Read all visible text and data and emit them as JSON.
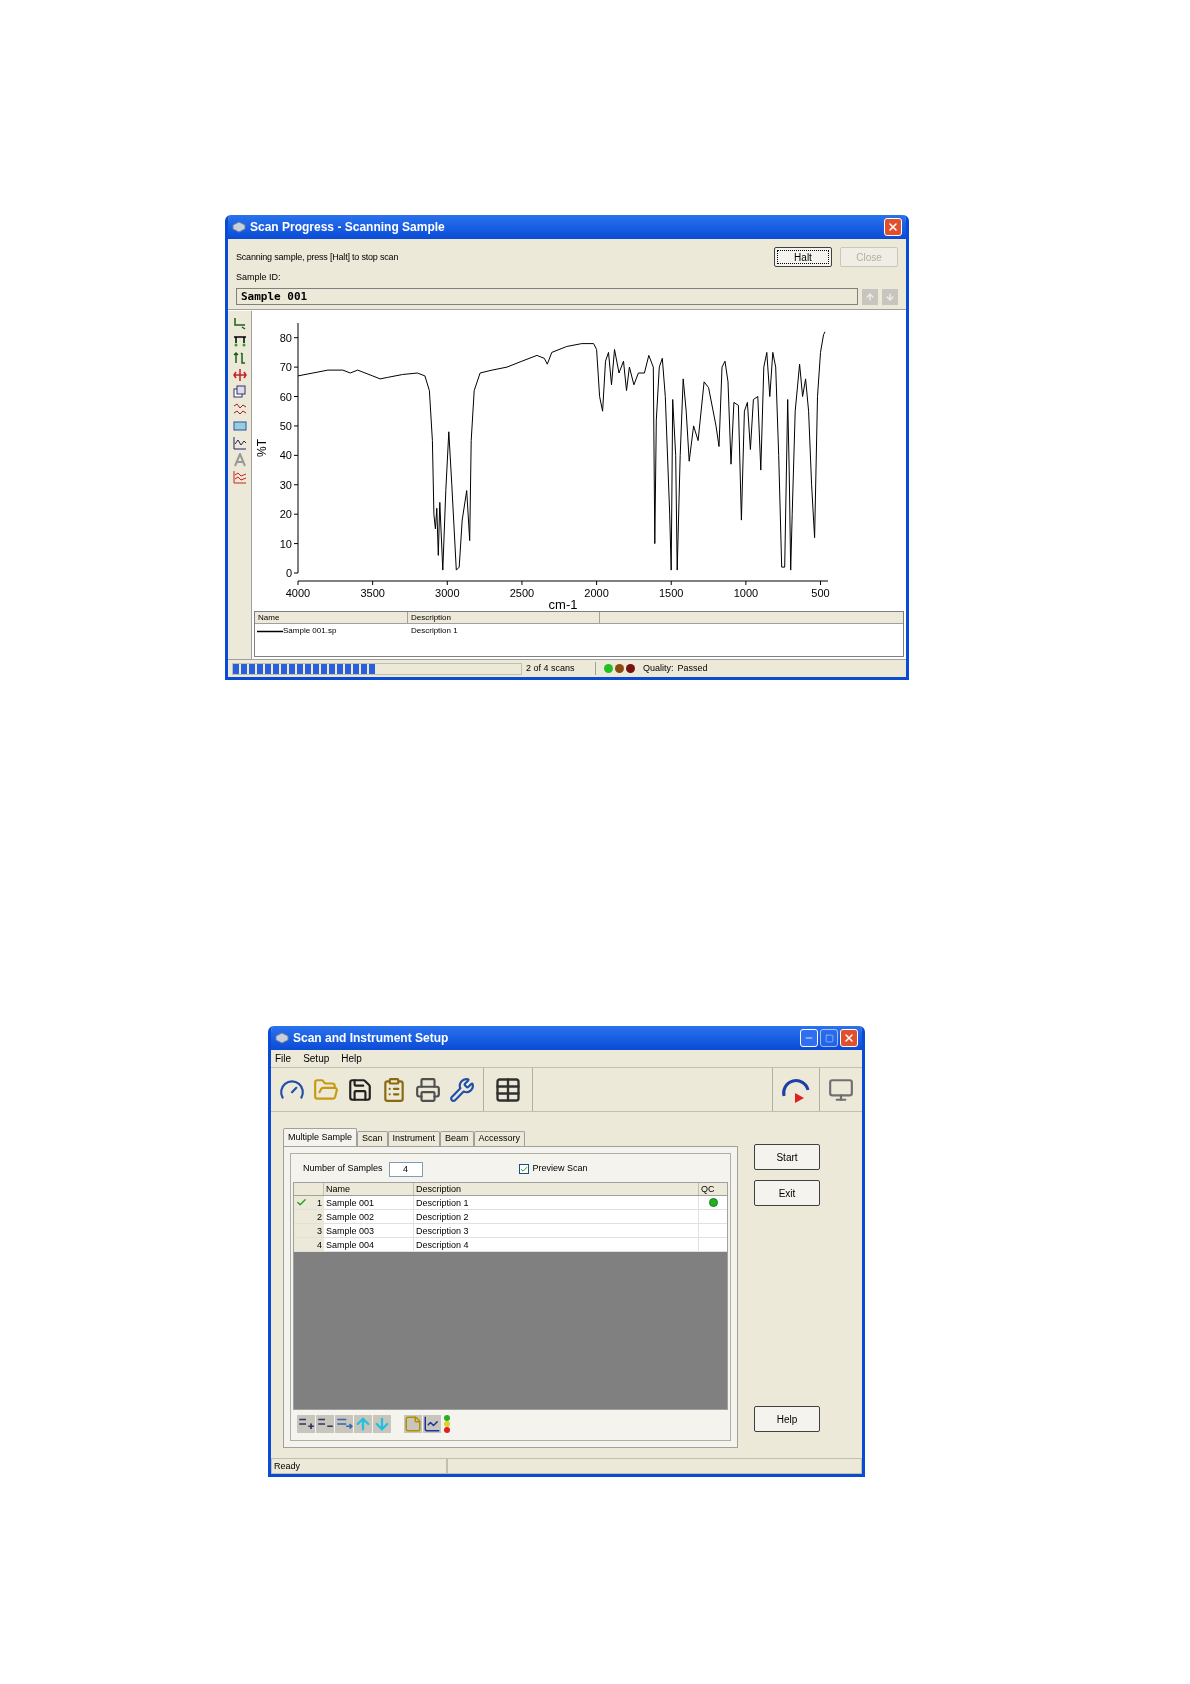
{
  "scan_progress_window": {
    "title": "Scan Progress - Scanning Sample",
    "message": "Scanning sample, press [Halt] to stop scan",
    "buttons": [
      {
        "label": "Halt",
        "disabled": false
      },
      {
        "label": "Close",
        "disabled": true
      }
    ],
    "sample_id_label": "Sample ID:",
    "sample_id_value": "Sample 001",
    "chart_data": {
      "type": "line",
      "xlabel": "cm-1",
      "ylabel": "%T",
      "xlim": [
        4000,
        450
      ],
      "ylim": [
        0,
        85
      ],
      "xticks": [
        4000,
        3500,
        3000,
        2500,
        2000,
        1500,
        1000,
        500
      ],
      "yticks": [
        0,
        10,
        20,
        30,
        40,
        50,
        60,
        70,
        80
      ],
      "x": [
        4000,
        3900,
        3800,
        3700,
        3650,
        3600,
        3500,
        3450,
        3400,
        3300,
        3200,
        3150,
        3120,
        3100,
        3090,
        3080,
        3070,
        3060,
        3050,
        3030,
        3010,
        2990,
        2970,
        2940,
        2920,
        2900,
        2870,
        2850,
        2840,
        2820,
        2780,
        2700,
        2600,
        2500,
        2400,
        2350,
        2330,
        2300,
        2200,
        2100,
        2020,
        2000,
        1980,
        1960,
        1940,
        1920,
        1900,
        1880,
        1850,
        1820,
        1800,
        1780,
        1750,
        1720,
        1680,
        1650,
        1620,
        1610,
        1600,
        1580,
        1560,
        1540,
        1510,
        1500,
        1490,
        1470,
        1460,
        1440,
        1420,
        1400,
        1380,
        1350,
        1320,
        1280,
        1250,
        1200,
        1180,
        1160,
        1140,
        1120,
        1100,
        1080,
        1050,
        1030,
        1010,
        990,
        970,
        950,
        920,
        900,
        880,
        860,
        840,
        820,
        800,
        780,
        760,
        740,
        720,
        710,
        700,
        690,
        670,
        640,
        620,
        600,
        580,
        560,
        540,
        520,
        500,
        480,
        470
      ],
      "series": [
        {
          "name": "Sample 001.sp",
          "color": "#000000",
          "values": [
            67,
            68,
            69,
            69,
            68,
            69,
            67,
            66,
            66.5,
            67.5,
            68,
            67,
            62,
            45,
            20,
            15,
            22,
            6,
            24,
            1,
            28,
            48,
            30,
            1,
            2,
            18,
            28,
            11,
            45,
            62,
            68,
            69,
            70,
            72,
            74,
            73,
            71,
            75,
            77,
            78,
            78,
            76,
            60,
            55,
            72,
            75,
            64,
            76,
            68,
            72,
            62,
            70,
            64,
            68,
            68,
            74,
            70,
            10,
            52,
            70,
            73,
            60,
            20,
            1,
            59,
            40,
            1,
            40,
            66,
            55,
            38,
            50,
            45,
            65,
            63,
            50,
            43,
            70,
            72,
            65,
            37,
            58,
            57,
            18,
            55,
            58,
            42,
            59,
            60,
            35,
            70,
            75,
            60,
            75,
            70,
            40,
            2,
            2,
            59,
            35,
            1,
            20,
            55,
            71,
            60,
            66,
            55,
            30,
            12,
            60,
            75,
            81,
            82
          ]
        }
      ]
    },
    "legend": {
      "columns": [
        "Name",
        "Description"
      ],
      "rows": [
        {
          "description": "Description 1"
        }
      ]
    },
    "status_bar": {
      "progress": {
        "level": 0.5
      },
      "scans": "2 of 4 scans",
      "quality_lights": [
        {
          "color": "#22c022"
        },
        {
          "color": "#8b4a12"
        },
        {
          "color": "#7a1010"
        }
      ],
      "quality_label": "Quality:",
      "quality_value": "Passed"
    }
  },
  "setup_window": {
    "title": "Scan and Instrument Setup",
    "menu": [
      "File",
      "Setup",
      "Help"
    ],
    "tabs": [
      {
        "label": "Multiple Sample",
        "selected": true
      },
      {
        "label": "Scan",
        "selected": false
      },
      {
        "label": "Instrument",
        "selected": false
      },
      {
        "label": "Beam",
        "selected": false
      },
      {
        "label": "Accessory",
        "selected": false
      }
    ],
    "number_of_samples_label": "Number of Samples",
    "number_of_samples": "4",
    "preview_scan": {
      "label": "Preview Scan",
      "checked": true
    },
    "table": {
      "columns": [
        "Name",
        "Description",
        "QC"
      ],
      "rows": [
        {
          "index": "1",
          "name": "Sample 001",
          "description": "Description 1",
          "done": true,
          "qc_passed": true
        },
        {
          "index": "2",
          "name": "Sample 002",
          "description": "Description 2",
          "done": false,
          "qc_passed": false
        },
        {
          "index": "3",
          "name": "Sample 003",
          "description": "Description 3",
          "done": false,
          "qc_passed": false
        },
        {
          "index": "4",
          "name": "Sample 004",
          "description": "Description 4",
          "done": false,
          "qc_passed": false
        }
      ]
    },
    "buttons": [
      "Start",
      "Exit",
      "Help"
    ],
    "status_bar": "Ready"
  }
}
